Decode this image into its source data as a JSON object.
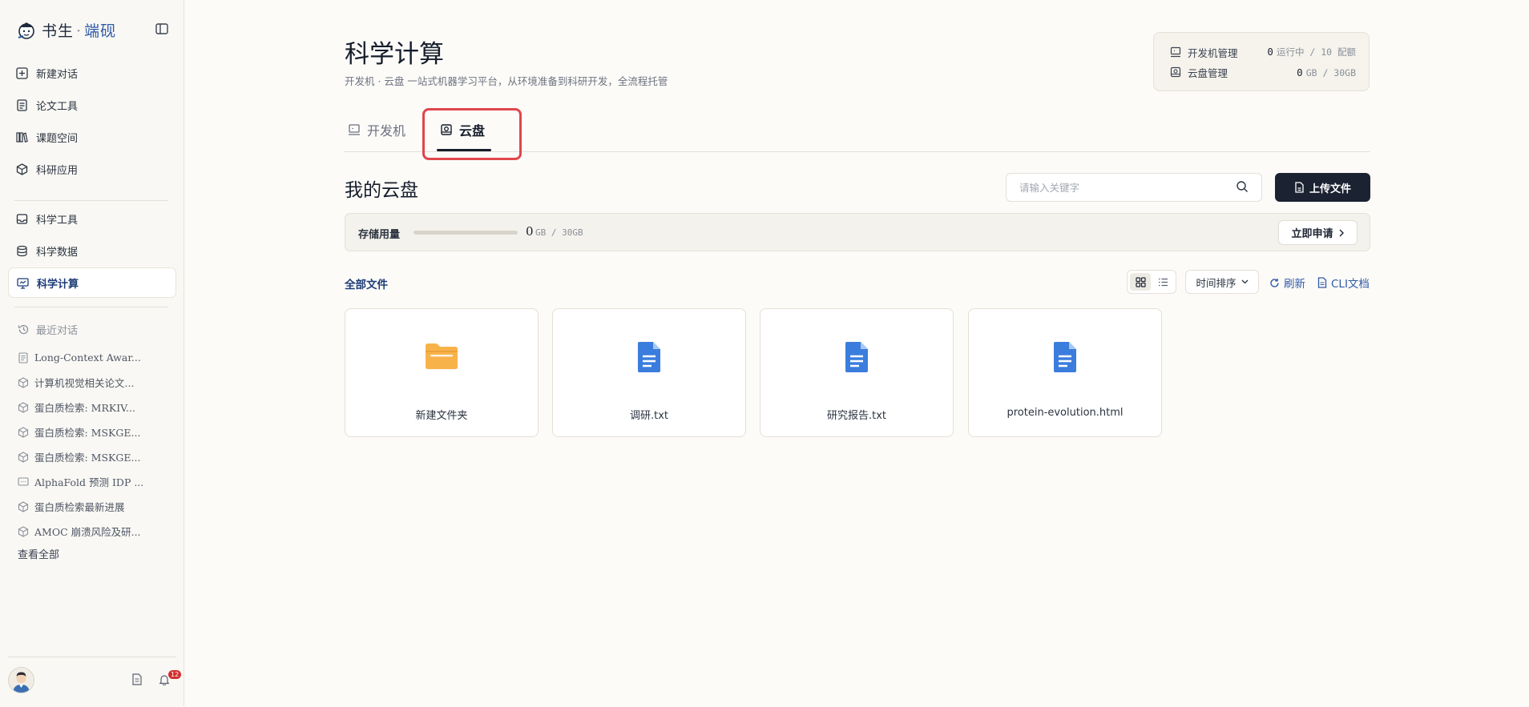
{
  "app": {
    "logo_text": "书生",
    "logo_dot": "·",
    "logo_accent": "端砚"
  },
  "sidebar": {
    "nav_primary": [
      {
        "label": "新建对话",
        "icon": "plus-square-icon"
      },
      {
        "label": "论文工具",
        "icon": "document-icon"
      },
      {
        "label": "课题空间",
        "icon": "books-icon"
      },
      {
        "label": "科研应用",
        "icon": "cube-icon"
      }
    ],
    "nav_secondary": [
      {
        "label": "科学工具",
        "icon": "tray-icon"
      },
      {
        "label": "科学数据",
        "icon": "database-icon"
      },
      {
        "label": "科学计算",
        "icon": "monitor-icon",
        "active": true
      }
    ],
    "recent_title": "最近对话",
    "recent": [
      {
        "label": "Long-Context Awar...",
        "icon": "document-icon"
      },
      {
        "label": "计算机视觉相关论文...",
        "icon": "cube-icon"
      },
      {
        "label": "蛋白质检索: MRKIV...",
        "icon": "cube-icon"
      },
      {
        "label": "蛋白质检索: MSKGE...",
        "icon": "cube-icon"
      },
      {
        "label": "蛋白质检索: MSKGE...",
        "icon": "cube-icon"
      },
      {
        "label": "AlphaFold 预测 IDP ...",
        "icon": "chat-icon"
      },
      {
        "label": "蛋白质检索最新进展",
        "icon": "cube-icon"
      },
      {
        "label": "AMOC 崩溃风险及研...",
        "icon": "cube-icon"
      }
    ],
    "view_all": "查看全部",
    "notification_count": "12"
  },
  "header": {
    "title": "科学计算",
    "subtitle": "开发机 · 云盘 一站式机器学习平台，从环境准备到科研开发，全流程托管"
  },
  "quota": {
    "dev": {
      "label": "开发机管理",
      "value": "0",
      "unit": "运行中 / 10 配额"
    },
    "disk": {
      "label": "云盘管理",
      "value": "0",
      "unit": "GB / 30GB"
    }
  },
  "tabs": {
    "dev": "开发机",
    "disk": "云盘",
    "active": "disk"
  },
  "disk": {
    "title": "我的云盘",
    "search_placeholder": "请输入关键字",
    "upload_label": "上传文件",
    "storage_label": "存储用量",
    "storage_used": "0",
    "storage_total": "GB / 30GB",
    "storage_fraction": 0,
    "apply_label": "立即申请",
    "all_files": "全部文件",
    "sort_label": "时间排序",
    "refresh_label": "刷新",
    "cli_label": "CLI文档",
    "view_mode": "grid"
  },
  "files": [
    {
      "name": "新建文件夹",
      "type": "folder"
    },
    {
      "name": "调研.txt",
      "type": "doc"
    },
    {
      "name": "研究报告.txt",
      "type": "doc"
    },
    {
      "name": "protein-evolution.html",
      "type": "doc"
    }
  ],
  "colors": {
    "brand_navy": "#1d3d78",
    "link_blue": "#2f5aa8",
    "dark_button": "#1b2232",
    "highlight_red": "#e0464b",
    "folder_orange": "#f8b24a",
    "doc_blue": "#3b7ddd"
  }
}
